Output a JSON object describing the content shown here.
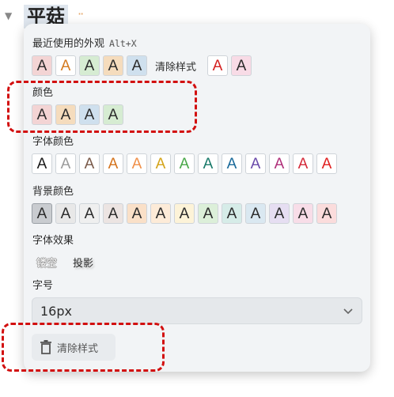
{
  "background": {
    "heading": "平菇",
    "dots": "··"
  },
  "recent": {
    "label": "最近使用的外观",
    "shortcut": "Alt+X",
    "swatches": [
      {
        "text": "A",
        "color": "#2b2b2b",
        "bg": "#f3d4d4"
      },
      {
        "text": "A",
        "color": "#d47a1f",
        "bg": "#ffffff"
      },
      {
        "text": "A",
        "color": "#2b2b2b",
        "bg": "#d6ecd2"
      },
      {
        "text": "A",
        "color": "#2b2b2b",
        "bg": "#f5dcbd"
      },
      {
        "text": "A",
        "color": "#2b2b2b",
        "bg": "#cfe0ee"
      }
    ],
    "clear_text": "清除样式",
    "swatches_after": [
      {
        "text": "A",
        "color": "#d42020",
        "bg": "#ffffff"
      },
      {
        "text": "A",
        "color": "#2b2b2b",
        "bg": "#f8dbe6"
      }
    ]
  },
  "color": {
    "label": "颜色",
    "swatches": [
      {
        "text": "A",
        "color": "#2b2b2b",
        "bg": "#f3d4d4"
      },
      {
        "text": "A",
        "color": "#2b2b2b",
        "bg": "#f5dcbd"
      },
      {
        "text": "A",
        "color": "#2b2b2b",
        "bg": "#cfe0ee"
      },
      {
        "text": "A",
        "color": "#2b2b2b",
        "bg": "#d6ecd2"
      }
    ]
  },
  "font_color": {
    "label": "字体颜色",
    "swatches": [
      {
        "text": "A",
        "color": "#1a1a1a",
        "bg": "#ffffff"
      },
      {
        "text": "A",
        "color": "#9b9b9b",
        "bg": "#ffffff"
      },
      {
        "text": "A",
        "color": "#7a5a4a",
        "bg": "#ffffff"
      },
      {
        "text": "A",
        "color": "#d4731d",
        "bg": "#ffffff"
      },
      {
        "text": "A",
        "color": "#f0904a",
        "bg": "#ffffff"
      },
      {
        "text": "A",
        "color": "#d4a41a",
        "bg": "#ffffff"
      },
      {
        "text": "A",
        "color": "#4aa84a",
        "bg": "#ffffff"
      },
      {
        "text": "A",
        "color": "#1a7a6a",
        "bg": "#ffffff"
      },
      {
        "text": "A",
        "color": "#1a6a9a",
        "bg": "#ffffff"
      },
      {
        "text": "A",
        "color": "#6a4aaa",
        "bg": "#ffffff"
      },
      {
        "text": "A",
        "color": "#b0307a",
        "bg": "#ffffff"
      },
      {
        "text": "A",
        "color": "#d42a3a",
        "bg": "#ffffff"
      },
      {
        "text": "A",
        "color": "#e02020",
        "bg": "#ffffff"
      }
    ]
  },
  "bg_color": {
    "label": "背景颜色",
    "swatches": [
      {
        "text": "A",
        "color": "#2b2b2b",
        "bg": "#c9ccd0"
      },
      {
        "text": "A",
        "color": "#2b2b2b",
        "bg": "#e8e8e8"
      },
      {
        "text": "A",
        "color": "#2b2b2b",
        "bg": "#efefef"
      },
      {
        "text": "A",
        "color": "#2b2b2b",
        "bg": "#ece4e2"
      },
      {
        "text": "A",
        "color": "#2b2b2b",
        "bg": "#fae0c8"
      },
      {
        "text": "A",
        "color": "#2b2b2b",
        "bg": "#fdebd8"
      },
      {
        "text": "A",
        "color": "#2b2b2b",
        "bg": "#fdf3d8"
      },
      {
        "text": "A",
        "color": "#2b2b2b",
        "bg": "#dcefd9"
      },
      {
        "text": "A",
        "color": "#2b2b2b",
        "bg": "#d6ece8"
      },
      {
        "text": "A",
        "color": "#2b2b2b",
        "bg": "#dae8f1"
      },
      {
        "text": "A",
        "color": "#2b2b2b",
        "bg": "#e6def2"
      },
      {
        "text": "A",
        "color": "#2b2b2b",
        "bg": "#f8dde8"
      },
      {
        "text": "A",
        "color": "#2b2b2b",
        "bg": "#fbdcdc"
      }
    ]
  },
  "effects": {
    "label": "字体效果",
    "hollow": "镂空",
    "shadow": "投影"
  },
  "font_size": {
    "label": "字号",
    "value": "16px"
  },
  "clear_button": {
    "label": "清除样式"
  },
  "colors": {
    "highlight_dash": "#d20f0f",
    "panel_bg": "#f2f4f6"
  }
}
